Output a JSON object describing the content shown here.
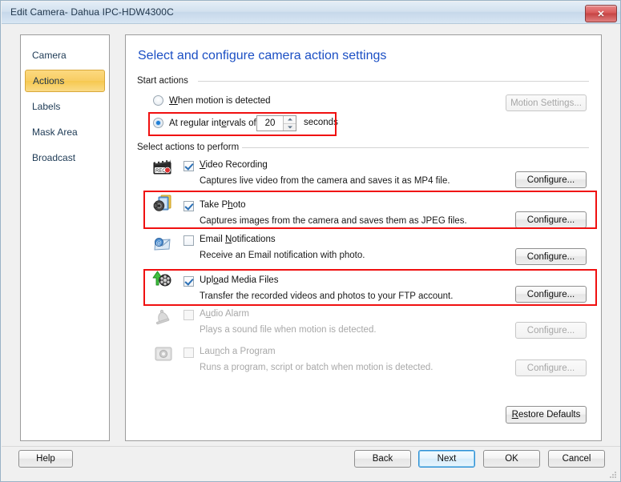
{
  "window": {
    "title": "Edit Camera- Dahua IPC-HDW4300C",
    "close_label": "✕"
  },
  "sidebar": {
    "items": [
      {
        "label": "Camera",
        "selected": false
      },
      {
        "label": "Actions",
        "selected": true
      },
      {
        "label": "Labels",
        "selected": false
      },
      {
        "label": "Mask Area",
        "selected": false
      },
      {
        "label": "Broadcast",
        "selected": false
      }
    ]
  },
  "main": {
    "page_title": "Select and configure camera action settings",
    "start_actions": {
      "group_label": "Start actions",
      "motion_radio_label": "When motion is detected",
      "motion_radio_selected": false,
      "interval_radio_label": "At regular intervals of",
      "interval_radio_selected": true,
      "interval_value": "20",
      "interval_units": "seconds",
      "motion_settings_label": "Motion Settings...",
      "motion_settings_enabled": false
    },
    "actions_group_label": "Select actions to perform",
    "configure_label": "Configure...",
    "restore_defaults_label": "Restore Defaults",
    "actions": [
      {
        "icon": "video-recording-icon",
        "title": "Video Recording",
        "underline_index": 0,
        "description": "Captures live video from the camera and saves it as MP4 file.",
        "checked": true,
        "enabled": true,
        "highlighted": false
      },
      {
        "icon": "take-photo-icon",
        "title": "Take Photo",
        "underline_index": 6,
        "description": "Captures images from the camera and saves them as JPEG files.",
        "checked": true,
        "enabled": true,
        "highlighted": true
      },
      {
        "icon": "email-notifications-icon",
        "title": "Email Notifications",
        "underline_index": 6,
        "description": "Receive an Email notification with photo.",
        "checked": false,
        "enabled": true,
        "highlighted": false
      },
      {
        "icon": "upload-media-files-icon",
        "title": "Upload Media Files",
        "underline_index": 3,
        "description": "Transfer the recorded videos and photos to your FTP account.",
        "checked": true,
        "enabled": true,
        "highlighted": true
      },
      {
        "icon": "audio-alarm-icon",
        "title": "Audio Alarm",
        "underline_index": 1,
        "description": "Plays a sound file when motion is detected.",
        "checked": false,
        "enabled": false,
        "highlighted": false
      },
      {
        "icon": "launch-program-icon",
        "title": "Launch a Program",
        "underline_index": 3,
        "description": "Runs a program, script or batch when motion is detected.",
        "checked": false,
        "enabled": false,
        "highlighted": false
      }
    ]
  },
  "footer": {
    "help_label": "Help",
    "back_label": "Back",
    "next_label": "Next",
    "ok_label": "OK",
    "cancel_label": "Cancel",
    "focused_button": "Next"
  },
  "colors": {
    "title_text": "#21374c",
    "page_title": "#1b4fc4",
    "selection_gold": "#f6c84f",
    "annotation_red": "#f01010",
    "close_red": "#c64343"
  }
}
